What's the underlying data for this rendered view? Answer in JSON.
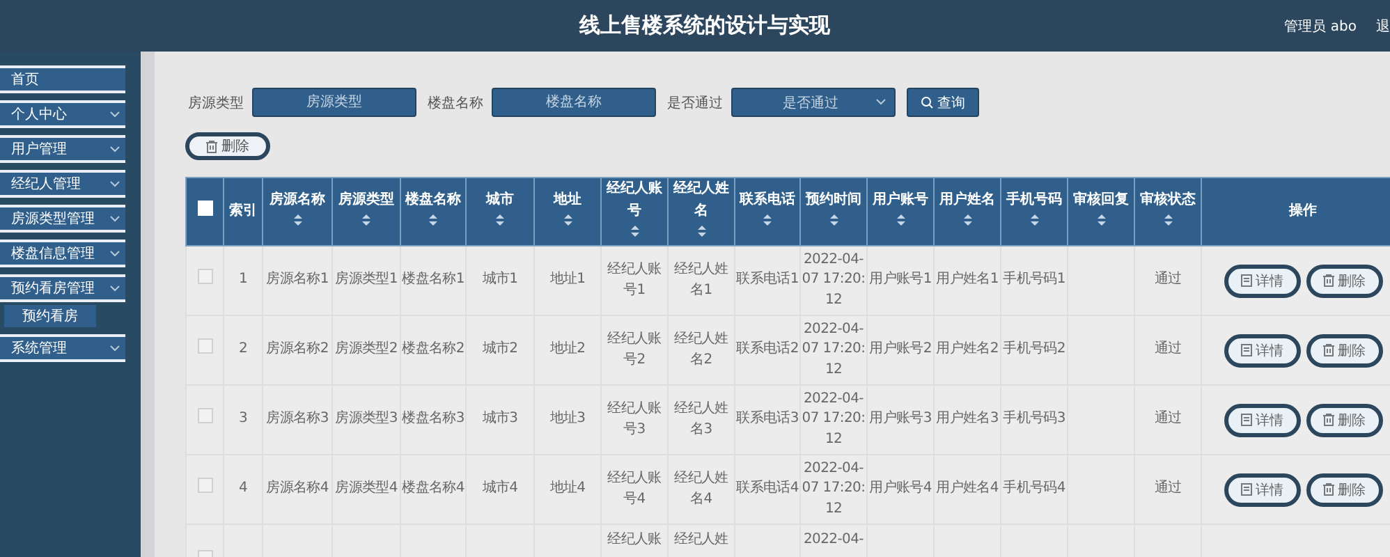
{
  "header": {
    "title": "线上售楼系统的设计与实现",
    "user": "管理员 abo",
    "logout": "退"
  },
  "sidebar": {
    "items": [
      {
        "label": "首页",
        "expandable": false
      },
      {
        "label": "个人中心",
        "expandable": true
      },
      {
        "label": "用户管理",
        "expandable": true
      },
      {
        "label": "经纪人管理",
        "expandable": true
      },
      {
        "label": "房源类型管理",
        "expandable": true
      },
      {
        "label": "楼盘信息管理",
        "expandable": true
      },
      {
        "label": "预约看房管理",
        "expandable": true,
        "children": [
          {
            "label": "预约看房"
          }
        ]
      },
      {
        "label": "系统管理",
        "expandable": true
      }
    ]
  },
  "filters": [
    {
      "kind": "input",
      "label": "房源类型",
      "placeholder": "房源类型"
    },
    {
      "kind": "input",
      "label": "楼盘名称",
      "placeholder": "楼盘名称"
    },
    {
      "kind": "select",
      "label": "是否通过",
      "placeholder": "是否通过"
    }
  ],
  "search_button": {
    "label": "查询"
  },
  "delete_button": {
    "label": "删除"
  },
  "table": {
    "select_all": {
      "checked": false
    },
    "columns": [
      {
        "label": "索引",
        "sortable": false
      },
      {
        "label": "房源名称",
        "sortable": true
      },
      {
        "label": "房源类型",
        "sortable": true
      },
      {
        "label": "楼盘名称",
        "sortable": true
      },
      {
        "label": "城市",
        "sortable": true
      },
      {
        "label": "地址",
        "sortable": true
      },
      {
        "label": "经纪人账号",
        "sortable": true
      },
      {
        "label": "经纪人姓名",
        "sortable": true
      },
      {
        "label": "联系电话",
        "sortable": true
      },
      {
        "label": "预约时间",
        "sortable": true
      },
      {
        "label": "用户账号",
        "sortable": true
      },
      {
        "label": "用户姓名",
        "sortable": true
      },
      {
        "label": "手机号码",
        "sortable": true
      },
      {
        "label": "审核回复",
        "sortable": true
      },
      {
        "label": "审核状态",
        "sortable": true
      },
      {
        "label": "操作",
        "sortable": false
      }
    ],
    "rows": [
      {
        "checked": false,
        "cells": {
          "index": "1",
          "listing_name": "房源名称1",
          "listing_type": "房源类型1",
          "building_name": "楼盘名称1",
          "city": "城市1",
          "address": "地址1",
          "agent_account": "经纪人账号1",
          "agent_name": "经纪人姓名1",
          "phone": "联系电话1",
          "booking_time": "2022-04-07 17:20:12",
          "user_account": "用户账号1",
          "user_name": "用户姓名1",
          "mobile": "手机号码1",
          "status": "通过"
        },
        "actions": [
          {
            "kind": "detail",
            "label": "详情"
          },
          {
            "kind": "delete",
            "label": "删除"
          }
        ]
      },
      {
        "checked": false,
        "cells": {
          "index": "2",
          "listing_name": "房源名称2",
          "listing_type": "房源类型2",
          "building_name": "楼盘名称2",
          "city": "城市2",
          "address": "地址2",
          "agent_account": "经纪人账号2",
          "agent_name": "经纪人姓名2",
          "phone": "联系电话2",
          "booking_time": "2022-04-07 17:20:12",
          "user_account": "用户账号2",
          "user_name": "用户姓名2",
          "mobile": "手机号码2",
          "status": "通过"
        },
        "actions": [
          {
            "kind": "detail",
            "label": "详情"
          },
          {
            "kind": "delete",
            "label": "删除"
          }
        ]
      },
      {
        "checked": false,
        "cells": {
          "index": "3",
          "listing_name": "房源名称3",
          "listing_type": "房源类型3",
          "building_name": "楼盘名称3",
          "city": "城市3",
          "address": "地址3",
          "agent_account": "经纪人账号3",
          "agent_name": "经纪人姓名3",
          "phone": "联系电话3",
          "booking_time": "2022-04-07 17:20:12",
          "user_account": "用户账号3",
          "user_name": "用户姓名3",
          "mobile": "手机号码3",
          "status": "通过"
        },
        "actions": [
          {
            "kind": "detail",
            "label": "详情"
          },
          {
            "kind": "delete",
            "label": "删除"
          }
        ]
      },
      {
        "checked": false,
        "cells": {
          "index": "4",
          "listing_name": "房源名称4",
          "listing_type": "房源类型4",
          "building_name": "楼盘名称4",
          "city": "城市4",
          "address": "地址4",
          "agent_account": "经纪人账号4",
          "agent_name": "经纪人姓名4",
          "phone": "联系电话4",
          "booking_time": "2022-04-07 17:20:12",
          "user_account": "用户账号4",
          "user_name": "用户姓名4",
          "mobile": "手机号码4",
          "status": "通过"
        },
        "actions": [
          {
            "kind": "detail",
            "label": "详情"
          },
          {
            "kind": "delete",
            "label": "删除"
          }
        ]
      },
      {
        "checked": false,
        "cells": {
          "agent_account": "经纪人账",
          "agent_name": "经纪人姓",
          "booking_time": "2022-04-"
        },
        "actions": []
      }
    ]
  }
}
